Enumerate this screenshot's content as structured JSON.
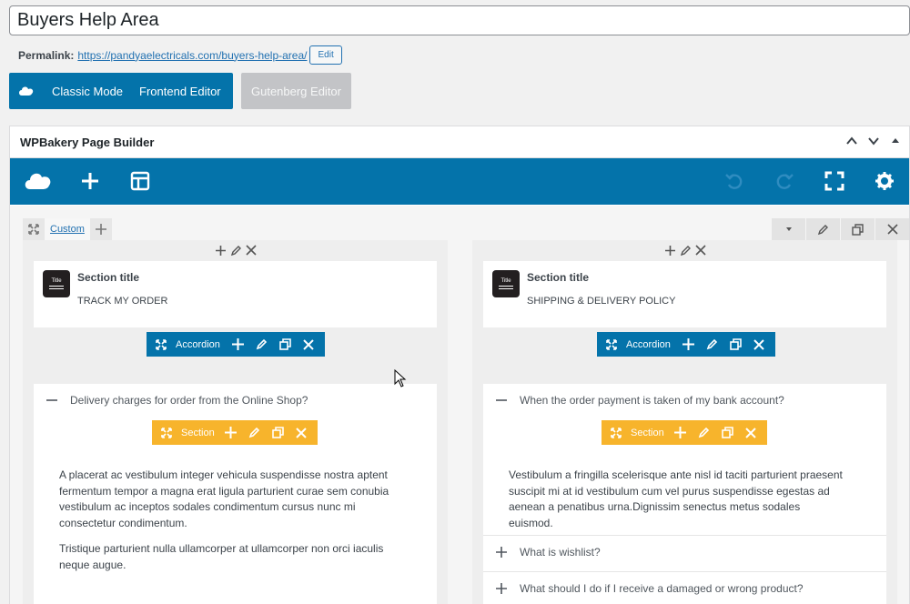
{
  "post": {
    "title": "Buyers Help Area"
  },
  "permalink": {
    "label": "Permalink:",
    "url": "https://pandyaelectricals.com/buyers-help-area/",
    "edit_label": "Edit"
  },
  "mode_bar": {
    "classic_label": "Classic Mode",
    "frontend_label": "Frontend Editor",
    "gutenberg_label": "Gutenberg Editor"
  },
  "panel": {
    "title": "WPBakery Page Builder"
  },
  "row": {
    "tab_label": "Custom"
  },
  "columns": [
    {
      "title_el": {
        "heading": "Section title",
        "value": "TRACK MY ORDER"
      },
      "accordion_label": "Accordion",
      "open_item": {
        "question": "Delivery charges for order from the Online Shop?",
        "section_label": "Section",
        "paragraphs": [
          "A placerat ac vestibulum integer vehicula suspendisse nostra aptent fermentum tempor a magna erat ligula parturient curae sem conubia vestibulum ac inceptos sodales condimentum cursus nunc mi consectetur condimentum.",
          "Tristique parturient nulla ullamcorper at ullamcorper non orci iaculis neque augue."
        ]
      },
      "closed_items": []
    },
    {
      "title_el": {
        "heading": "Section title",
        "value": "SHIPPING & DELIVERY POLICY"
      },
      "accordion_label": "Accordion",
      "open_item": {
        "question": "When the order payment is taken of my bank account?",
        "section_label": "Section",
        "paragraphs": [
          "Vestibulum a fringilla scelerisque ante nisl id taciti parturient praesent suscipit mi at id vestibulum cum vel purus suspendisse egestas ad aenean a penatibus urna.Dignissim senectus metus sodales euismod."
        ]
      },
      "closed_items": [
        "What is wishlist?",
        "What should I do if I receive a damaged or wrong product?"
      ]
    }
  ],
  "colors": {
    "brand_blue": "#0473aa",
    "section_orange": "#f7b42c"
  }
}
